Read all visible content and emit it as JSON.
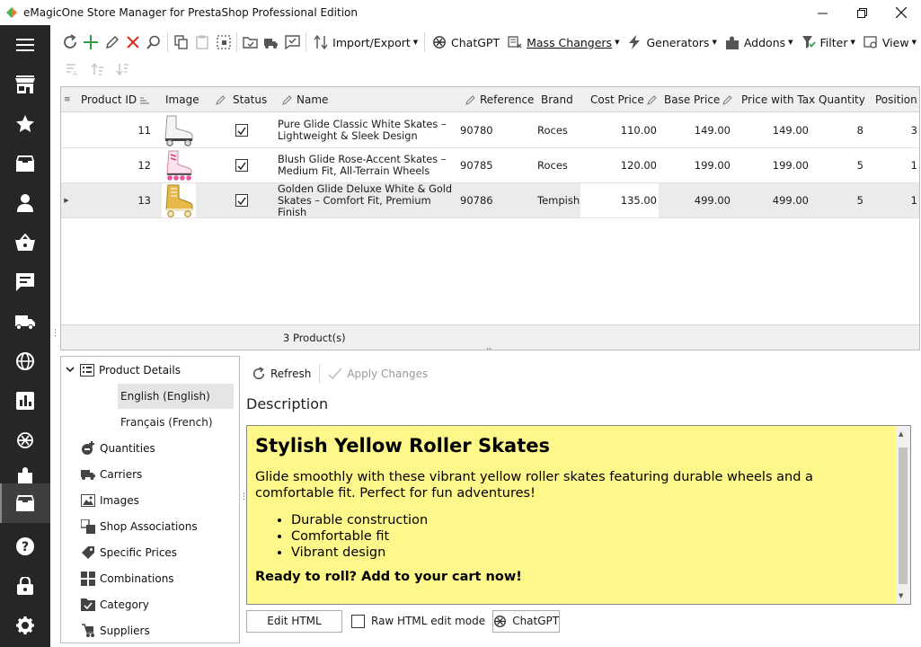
{
  "window": {
    "title": "eMagicOne Store Manager for PrestaShop Professional Edition"
  },
  "nav": {
    "items": [
      "hamburger-menu-icon",
      "store-icon",
      "star-icon",
      "archive-icon",
      "user-icon",
      "basket-icon",
      "chat-icon",
      "truck-icon",
      "globe-icon",
      "bar-chart-icon",
      "chatgpt-icon",
      "puzzle-icon",
      "box-icon",
      "help-icon",
      "lock-icon",
      "gear-icon"
    ],
    "active": "box-icon"
  },
  "toolbar": {
    "import_export": "Import/Export",
    "chatgpt": "ChatGPT",
    "mass_changers": "Mass Changers",
    "generators": "Generators",
    "addons": "Addons",
    "filter": "Filter",
    "view": "View"
  },
  "grid": {
    "columns": [
      "Product ID",
      "Image",
      "Status",
      "Name",
      "Reference",
      "Brand",
      "Cost Price",
      "Base Price",
      "Price with Tax",
      "Quantity",
      "Position"
    ],
    "rows": [
      {
        "id": "11",
        "status": true,
        "name": "Pure Glide Classic White Skates – Lightweight & Sleek Design",
        "reference": "90780",
        "brand": "Roces",
        "cost": "110.00",
        "base": "149.00",
        "tax": "149.00",
        "qty": "8",
        "pos": "3"
      },
      {
        "id": "12",
        "status": true,
        "name": "Blush Glide Rose-Accent Skates – Medium Fit, All-Terrain Wheels",
        "reference": "90785",
        "brand": "Roces",
        "cost": "120.00",
        "base": "199.00",
        "tax": "199.00",
        "qty": "5",
        "pos": "1"
      },
      {
        "id": "13",
        "status": true,
        "name": "Golden Glide Deluxe White & Gold Skates – Comfort Fit, Premium Finish",
        "reference": "90786",
        "brand": "Tempish",
        "cost": "135.00",
        "base": "499.00",
        "tax": "499.00",
        "qty": "5",
        "pos": "1"
      }
    ],
    "footer": "3 Product(s)"
  },
  "tree": {
    "product_details": "Product Details",
    "languages": [
      "English (English)",
      "Français (French)"
    ],
    "items": [
      "Quantities",
      "Carriers",
      "Images",
      "Shop Associations",
      "Specific Prices",
      "Combinations",
      "Category",
      "Suppliers"
    ]
  },
  "detail": {
    "refresh": "Refresh",
    "apply": "Apply Changes",
    "description_label": "Description",
    "heading": "Stylish Yellow Roller Skates",
    "paragraph": "Glide smoothly with these vibrant yellow roller skates featuring durable wheels and a comfortable fit. Perfect for fun adventures!",
    "bullets": [
      "Durable construction",
      "Comfortable fit",
      "Vibrant design"
    ],
    "cta": "Ready to roll? Add to your cart now!",
    "edit_html": "Edit HTML",
    "raw_html": "Raw HTML edit mode",
    "chatgpt": "ChatGPT"
  },
  "colors": {
    "nav_bg": "#262626",
    "description_bg": "#fef88b",
    "add_green": "#2ea043",
    "delete_red": "#d92d20"
  }
}
